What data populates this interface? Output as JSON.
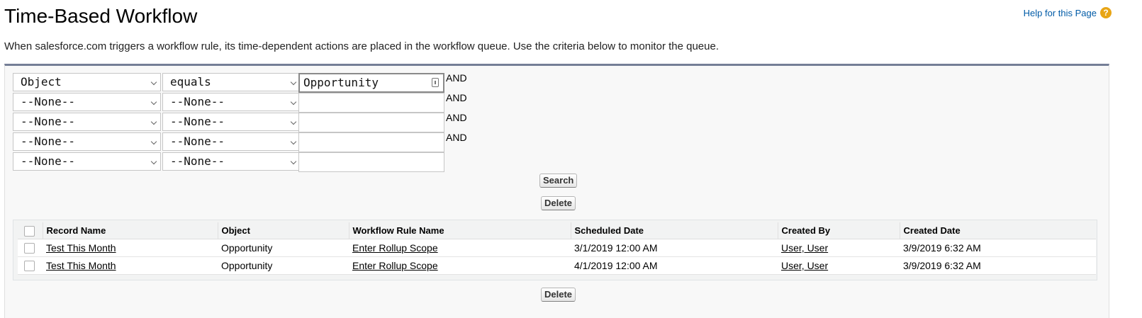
{
  "header": {
    "title": "Time-Based Workflow",
    "help_link": "Help for this Page",
    "help_icon": "?",
    "description": "When salesforce.com triggers a workflow rule, its time-dependent actions are placed in the workflow queue. Use the criteria below to monitor the queue."
  },
  "criteria": {
    "rows": [
      {
        "field": "Object",
        "operator": "equals",
        "value": "Opportunity",
        "connector": "AND"
      },
      {
        "field": "--None--",
        "operator": "--None--",
        "value": "",
        "connector": "AND"
      },
      {
        "field": "--None--",
        "operator": "--None--",
        "value": "",
        "connector": "AND"
      },
      {
        "field": "--None--",
        "operator": "--None--",
        "value": "",
        "connector": "AND"
      },
      {
        "field": "--None--",
        "operator": "--None--",
        "value": "",
        "connector": ""
      }
    ],
    "search_label": "Search",
    "delete_label": "Delete"
  },
  "results": {
    "columns": [
      "Record Name",
      "Object",
      "Workflow Rule Name",
      "Scheduled Date",
      "Created By",
      "Created Date"
    ],
    "rows": [
      {
        "record_name": "Test This Month",
        "object": "Opportunity",
        "workflow_rule": "Enter Rollup Scope",
        "scheduled_date": "3/1/2019 12:00 AM",
        "created_by": "User, User",
        "created_date": "3/9/2019 6:32 AM"
      },
      {
        "record_name": "Test This Month",
        "object": "Opportunity",
        "workflow_rule": "Enter Rollup Scope",
        "scheduled_date": "4/1/2019 12:00 AM",
        "created_by": "User, User",
        "created_date": "3/9/2019 6:32 AM"
      }
    ],
    "delete_label": "Delete"
  },
  "colors": {
    "panel_border": "#747e96",
    "help_icon": "#e8a515",
    "link": "#015ba7"
  }
}
